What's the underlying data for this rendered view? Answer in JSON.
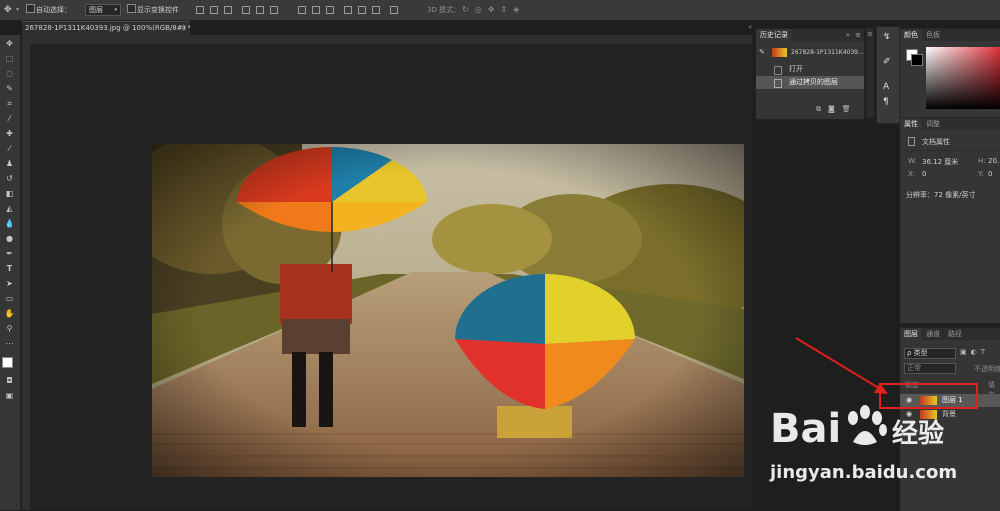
{
  "options_bar": {
    "auto_select_label": "自动选择：",
    "auto_select_value": "图层",
    "show_transform_label": "显示变换控件",
    "mode_3d_label": "3D 模式："
  },
  "document": {
    "tab_title": "267828-1P1311K40393.jpg @ 100%(RGB/8#) *",
    "close_glyph": "×"
  },
  "history_panel": {
    "title": "历史记录",
    "snapshot_name": "267828-1P1311K4039...",
    "items": [
      "打开",
      "通过拷贝的图层"
    ]
  },
  "color_panel": {
    "tabs": [
      "颜色",
      "色板"
    ],
    "fg_color": "#ffffff",
    "bg_color": "#000000"
  },
  "properties_panel": {
    "tabs": [
      "属性",
      "调整"
    ],
    "doc_props_label": "文档属性",
    "w_label": "W:",
    "w_value": "36.12 厘米",
    "h_label": "H:",
    "h_value": "20.",
    "x_label": "X:",
    "x_value": "0",
    "y_label": "Y:",
    "y_value": "0",
    "resolution": "分辨率：72 像素/英寸"
  },
  "layers_panel": {
    "tabs": [
      "图层",
      "通道",
      "路径"
    ],
    "filter_label": "ρ 类型",
    "blend_mode": "正常",
    "opacity_label": "不透明度",
    "lock_label": "锁定",
    "fill_label": "填充",
    "layers": [
      {
        "name": "图层 1",
        "selected": true
      },
      {
        "name": "背景",
        "selected": false
      }
    ]
  },
  "annotation": {
    "color": "#e0201a"
  },
  "watermark": {
    "brand": "Bai",
    "brand_suffix": "经验",
    "url": "jingyan.baidu.com"
  }
}
